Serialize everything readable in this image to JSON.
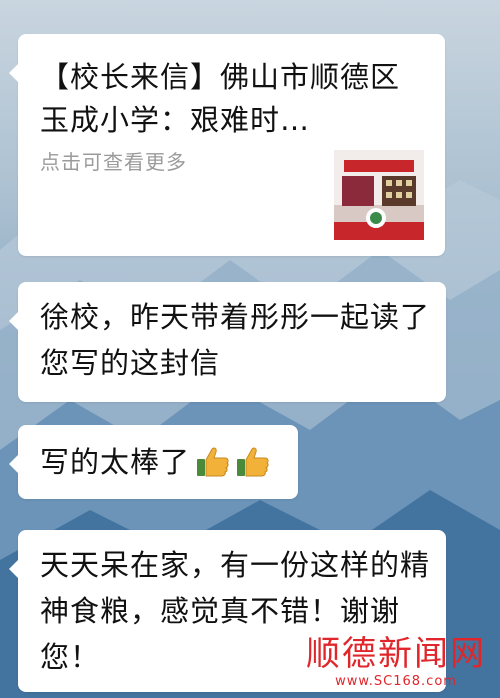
{
  "card": {
    "title": "【校长来信】佛山市顺德区玉成小学：艰难时…",
    "subtitle": "点击可查看更多"
  },
  "messages": [
    {
      "text": "徐校，昨天带着彤彤一起读了您写的这封信"
    },
    {
      "text": "写的太棒了",
      "emojis": [
        "thumbs-up-icon",
        "thumbs-up-icon"
      ]
    },
    {
      "text": "天天呆在家，有一份这样的精神食粮，感觉真不错！谢谢您！"
    }
  ],
  "watermark": {
    "title": "顺德新闻网",
    "url": "www.SC168.com"
  },
  "colors": {
    "watermark": "#e0262a",
    "bubble": "#ffffff",
    "sky_top": "#c9d5df",
    "sky_bottom": "#2f608e"
  }
}
